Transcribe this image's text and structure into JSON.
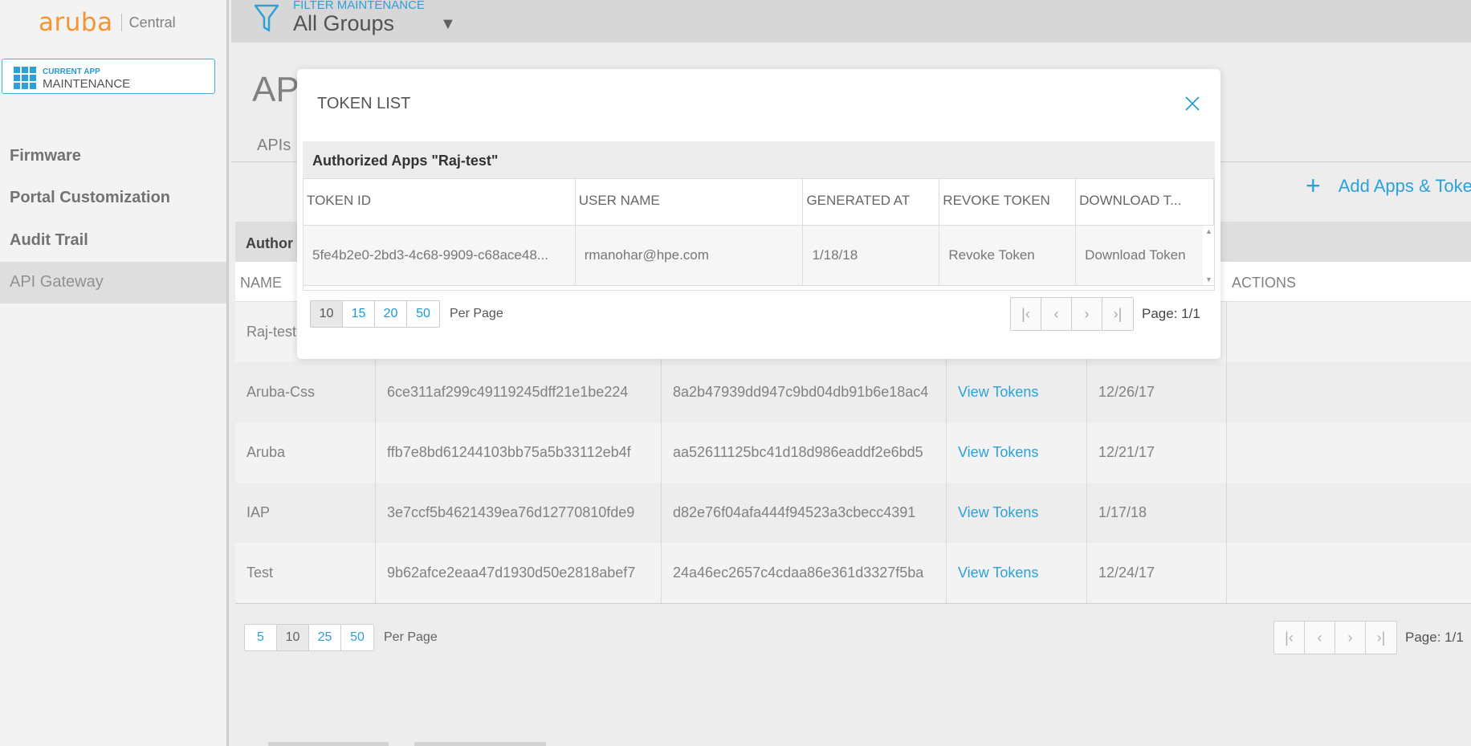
{
  "brand": {
    "logo": "aruba",
    "product": "Central"
  },
  "app_switch": {
    "caption": "CURRENT APP",
    "name": "MAINTENANCE"
  },
  "sidebar": {
    "items": [
      {
        "label": "Firmware"
      },
      {
        "label": "Portal Customization"
      },
      {
        "label": "Audit Trail"
      },
      {
        "label": "API Gateway"
      }
    ]
  },
  "filter": {
    "label": "FILTER MAINTENANCE",
    "group": "All Groups"
  },
  "page": {
    "title": "AP",
    "tab_apis": "APIs",
    "add_button": "Add Apps & Tokens"
  },
  "main_table": {
    "section": "Author",
    "headers": [
      "NAME",
      "",
      "",
      "",
      "",
      "ACTIONS"
    ],
    "rows": [
      {
        "name": "Raj-test",
        "client_id": "",
        "secret": "",
        "action": "",
        "date": ""
      },
      {
        "name": "Aruba-Css",
        "client_id": "6ce311af299c49119245dff21e1be224",
        "secret": "8a2b47939dd947c9bd04db91b6e18ac4",
        "action": "View Tokens",
        "date": "12/26/17"
      },
      {
        "name": "Aruba",
        "client_id": "ffb7e8bd61244103bb75a5b33112eb4f",
        "secret": "aa52611125bc41d18d986eaddf2e6bd5",
        "action": "View Tokens",
        "date": "12/21/17"
      },
      {
        "name": "IAP",
        "client_id": "3e7ccf5b4621439ea76d12770810fde9",
        "secret": "d82e76f04afa444f94523a3cbecc4391",
        "action": "View Tokens",
        "date": "1/17/18"
      },
      {
        "name": "Test",
        "client_id": "9b62afce2eaa47d1930d50e2818abef7",
        "secret": "24a46ec2657c4cdaa86e361d3327f5ba",
        "action": "View Tokens",
        "date": "12/24/17"
      }
    ],
    "pager": {
      "sizes": [
        "5",
        "10",
        "25",
        "50"
      ],
      "selected": "10",
      "per_page": "Per Page",
      "page": "Page: 1/1"
    }
  },
  "modal": {
    "title": "TOKEN LIST",
    "section": "Authorized Apps \"Raj-test\"",
    "headers": [
      "TOKEN ID",
      "USER NAME",
      "GENERATED AT",
      "REVOKE TOKEN",
      "DOWNLOAD T..."
    ],
    "rows": [
      {
        "token_id": "5fe4b2e0-2bd3-4c68-9909-c68ace48...",
        "user": "rmanohar@hpe.com",
        "generated": "1/18/18",
        "revoke": "Revoke Token",
        "download": "Download Token"
      }
    ],
    "pager": {
      "sizes": [
        "10",
        "15",
        "20",
        "50"
      ],
      "selected": "10",
      "per_page": "Per Page",
      "page": "Page: 1/1"
    }
  },
  "colors": {
    "accent": "#1a9ad6",
    "brand_orange": "#f08c24"
  }
}
